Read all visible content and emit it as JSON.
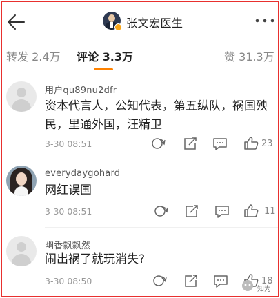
{
  "header": {
    "title": "张文宏医生"
  },
  "tabs": {
    "repost": "转发 2.4万",
    "comment": "评论 3.3万",
    "like": "赞 31.3万",
    "active": "comment"
  },
  "comments": [
    {
      "user": "用户qu89nu2dfr",
      "text": "资本代言人，公知代表，第五纵队，祸国殃民，里通外国，汪精卫",
      "time": "3-30 08:51",
      "likes": "23",
      "avatar": "default-avatar"
    },
    {
      "user": "everydaygohard",
      "text": "网红误国",
      "time": "3-30 08:51",
      "likes": "11",
      "avatar": "photo-avatar"
    },
    {
      "user": "幽香飘飘然",
      "text": "闹出祸了就玩消失?",
      "time": "3-30 08:50",
      "likes": "18",
      "avatar": "default-avatar"
    }
  ],
  "watermark": {
    "text": "知为"
  },
  "colors": {
    "frame": "#e8302e",
    "accent": "#ff8200",
    "muted": "#999999"
  }
}
